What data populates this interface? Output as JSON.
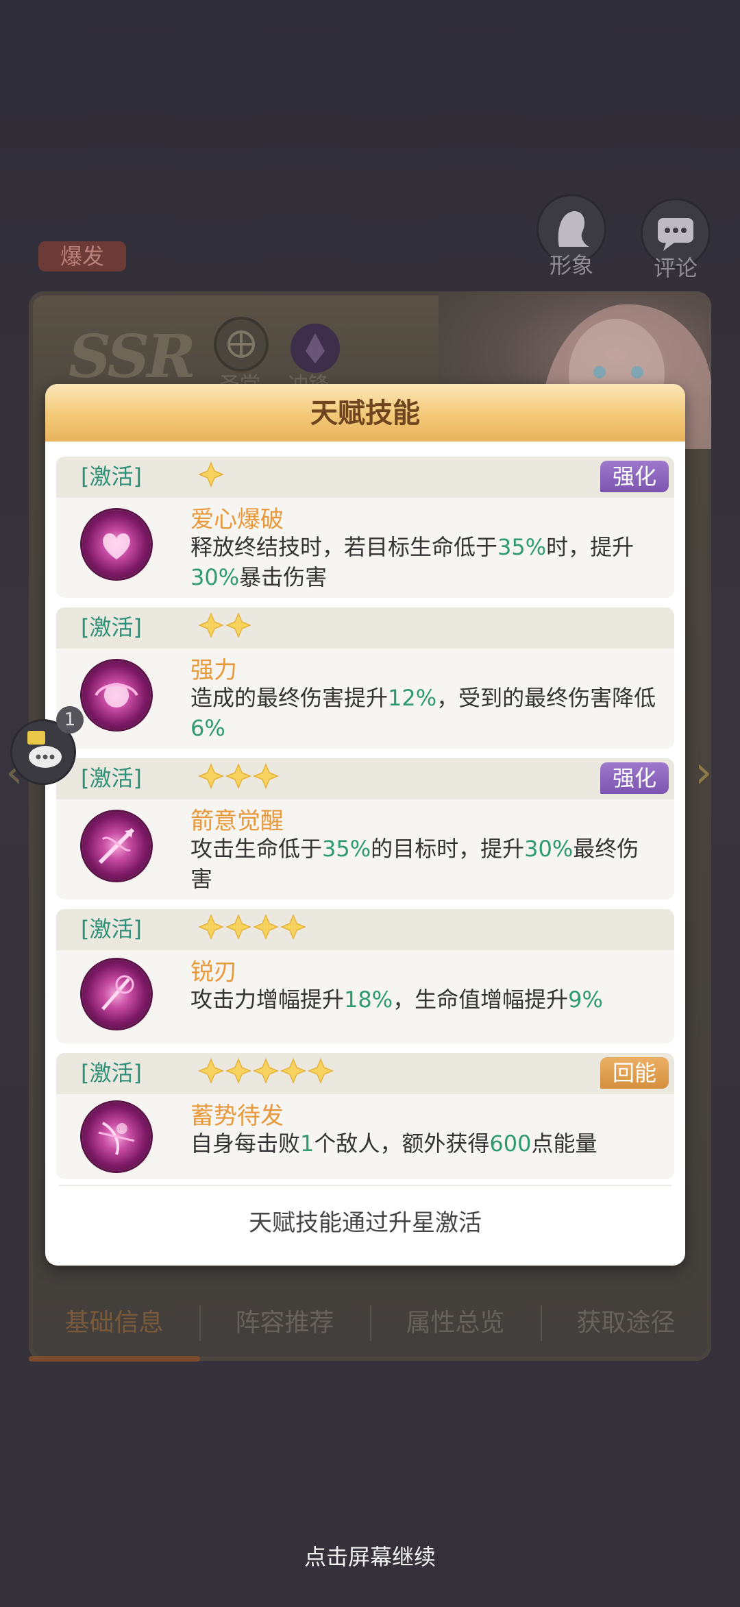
{
  "background": {
    "burst_tag": "爆发",
    "image_button_label": "形象",
    "comment_button_label": "评论",
    "rarity": "SSR",
    "class_1": "圣堂",
    "class_2": "冲锋",
    "chat_count": "1",
    "tabs": [
      "基础信息",
      "阵容推荐",
      "属性总览",
      "获取途径"
    ]
  },
  "modal": {
    "title": "天赋技能",
    "skills": [
      {
        "activate_label": "[激活]",
        "stars": 1,
        "tag": "强化",
        "tag_color": "#8a63be",
        "name": "爱心爆破",
        "desc": [
          "释放终结技时，若目标生命低于",
          "35%",
          "时，提升",
          "30%",
          "暴击伤害"
        ]
      },
      {
        "activate_label": "[激活]",
        "stars": 2,
        "tag": "",
        "name": "强力",
        "desc": [
          "造成的最终伤害提升",
          "12%",
          "，受到的最终伤害降低",
          "6%",
          ""
        ]
      },
      {
        "activate_label": "[激活]",
        "stars": 3,
        "tag": "强化",
        "tag_color": "#8a63be",
        "name": "箭意觉醒",
        "desc": [
          "攻击生命低于",
          "35%",
          "的目标时，提升",
          "30%",
          "最终伤害"
        ]
      },
      {
        "activate_label": "[激活]",
        "stars": 4,
        "tag": "",
        "name": "锐刃",
        "desc": [
          "攻击力增幅提升",
          "18%",
          "，生命值增幅提升",
          "9%",
          ""
        ]
      },
      {
        "activate_label": "[激活]",
        "stars": 5,
        "tag": "回能",
        "tag_color": "#df9d4a",
        "name": "蓄势待发",
        "desc": [
          "自身每击败",
          "1",
          "个敌人，额外获得",
          "600",
          "点能量"
        ]
      }
    ],
    "footer_note": "天赋技能通过升星激活"
  },
  "continue_hint": "点击屏幕继续",
  "colors": {
    "highlight_green": "#2e9a6d",
    "skill_name_orange": "#e7993c",
    "activate_green": "#2f8f76",
    "header_gold": "#f3c978"
  },
  "icons": {
    "star": "star-icon",
    "skill": "skill-emblem-icon",
    "chat": "chat-bubble-icon",
    "portrait": "character-silhouette-icon",
    "comment": "comment-icon"
  }
}
